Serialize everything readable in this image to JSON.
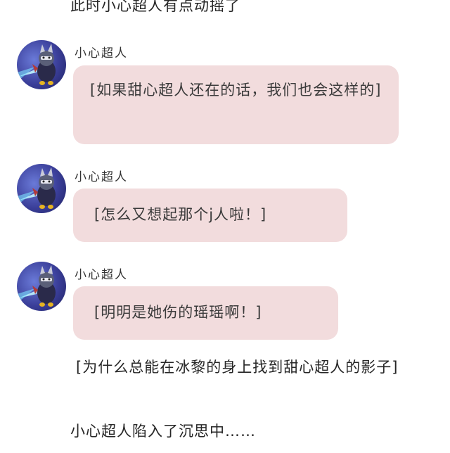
{
  "narration": {
    "top": "此时小心超人有点动摇了",
    "middle": "[为什么总能在冰黎的身上找到甜心超人的影子]",
    "bottom": "小心超人陷入了沉思中……"
  },
  "messages": [
    {
      "sender": "小心超人",
      "avatar_icon": "hero-avatar-icon",
      "text": "[如果甜心超人还在的话，我们也会这样的]"
    },
    {
      "sender": "小心超人",
      "avatar_icon": "hero-avatar-icon",
      "text": "[怎么又想起那个j人啦！]"
    },
    {
      "sender": "小心超人",
      "avatar_icon": "hero-avatar-icon",
      "text": "[明明是她伤的瑶瑶啊！]"
    }
  ],
  "colors": {
    "bubble": "#f2dcdd",
    "background": "#ffffff",
    "text": "#2b2b2b"
  }
}
